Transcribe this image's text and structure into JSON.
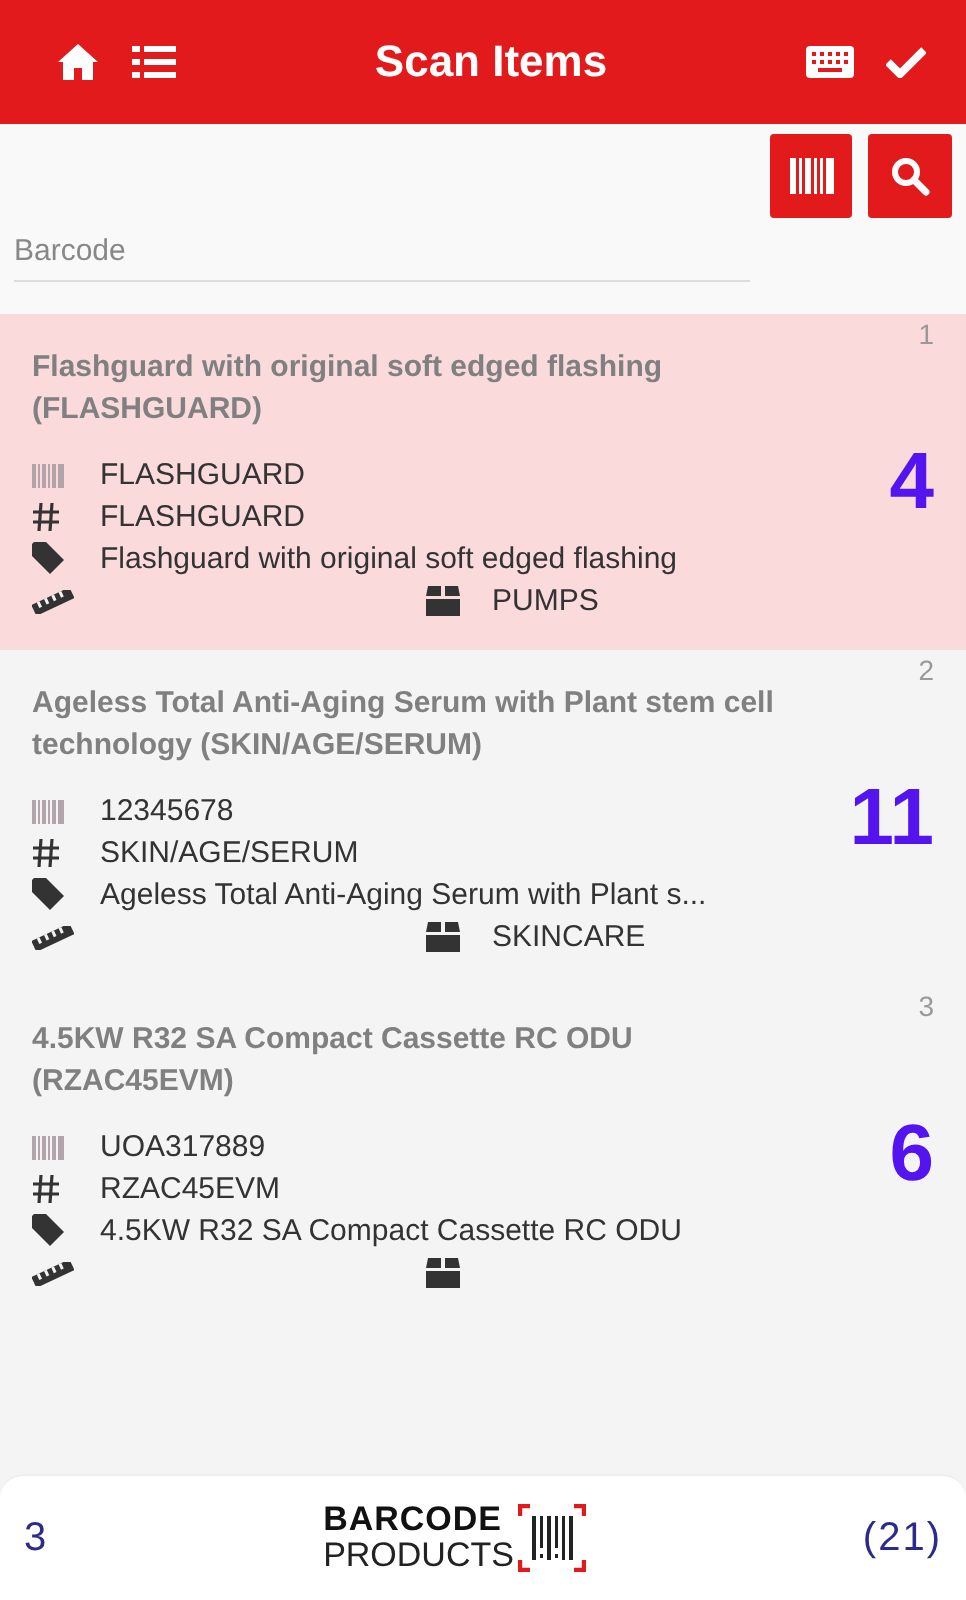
{
  "header": {
    "title": "Scan Items"
  },
  "search": {
    "placeholder": "Barcode"
  },
  "items": [
    {
      "index": "1",
      "title": "Flashguard with original soft edged flashing (FLASHGUARD)",
      "barcode": "FLASHGUARD",
      "code": "FLASHGUARD",
      "description": "Flashguard with original soft edged flashing",
      "category": "PUMPS",
      "quantity": "4",
      "selected": true
    },
    {
      "index": "2",
      "title": "Ageless Total Anti-Aging Serum with Plant stem cell technology (SKIN/AGE/SERUM)",
      "barcode": "12345678",
      "code": "SKIN/AGE/SERUM",
      "description": "Ageless Total Anti-Aging Serum with Plant s...",
      "category": "SKINCARE",
      "quantity": "11",
      "selected": false
    },
    {
      "index": "3",
      "title": "4.5KW R32 SA Compact Cassette RC ODU (RZAC45EVM)",
      "barcode": "UOA317889",
      "code": "RZAC45EVM",
      "description": "4.5KW R32 SA Compact Cassette RC ODU",
      "quantity": "6",
      "selected": false
    }
  ],
  "footer": {
    "item_count": "3",
    "logo_top": "BARCODE",
    "logo_bottom": "PRODUCTS",
    "total": "(21)"
  }
}
